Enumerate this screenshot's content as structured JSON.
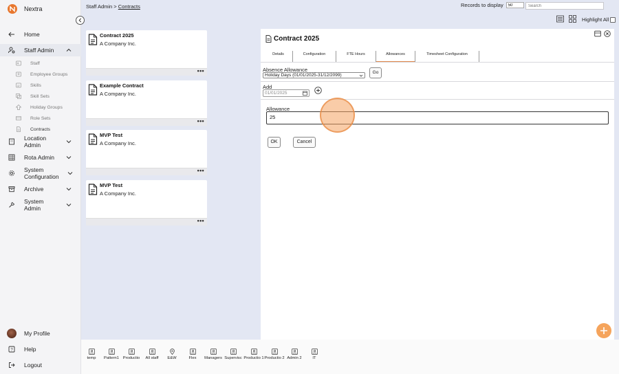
{
  "app": {
    "name": "Nextra"
  },
  "colors": {
    "accent": "#e8772e",
    "fab": "#f5a45c",
    "tab_underline": "#e0874a"
  },
  "nav": {
    "home": "Home",
    "staff_admin": "Staff Admin",
    "sub_items": [
      "Staff",
      "Employee Groups",
      "Skills",
      "Skill Sets",
      "Holiday Groups",
      "Role Sets",
      "Contracts"
    ],
    "location_admin": "Location Admin",
    "rota_admin": "Rota Admin",
    "system_configuration": "System Configuration",
    "archive": "Archive",
    "system_admin": "System Admin",
    "my_profile": "My Profile",
    "help": "Help",
    "logout": "Logout"
  },
  "header": {
    "breadcrumb_parent": "Staff Admin",
    "breadcrumb_sep": " > ",
    "breadcrumb_current": "Contracts",
    "records_label": "Records to display",
    "records_value": "50",
    "search_placeholder": "Search",
    "highlight_all": "Highlight All"
  },
  "cards": [
    {
      "title": "Contract 2025",
      "company": "A Company Inc."
    },
    {
      "title": "Example Contract",
      "company": "A Company Inc."
    },
    {
      "title": "MVP Test",
      "company": "A Company Inc."
    },
    {
      "title": "MVP Test",
      "company": "A Company Inc."
    }
  ],
  "card_more": "•••",
  "panel": {
    "title": "Contract 2025",
    "tabs": [
      "Details",
      "Configuration",
      "FTE Hours",
      "Allowances",
      "Timesheet Configuration"
    ],
    "active_tab": "Allowances",
    "absence_label": "Absence Allowance",
    "absence_selected": "Holiday Days (01/01/2025-31/12/2099)",
    "go": "Go",
    "add_label": "Add",
    "add_date": "01/01/2025",
    "allowance_label": "Allowance",
    "allowance_value": "25",
    "ok": "OK",
    "cancel": "Cancel"
  },
  "bottom_items": [
    "temp",
    "Pattern1",
    "Productio",
    "All staff",
    "E&W",
    "Flex",
    "Managers",
    "Supervisc",
    "Productio 1",
    "Productio 2",
    "Admin 2",
    "IT"
  ]
}
